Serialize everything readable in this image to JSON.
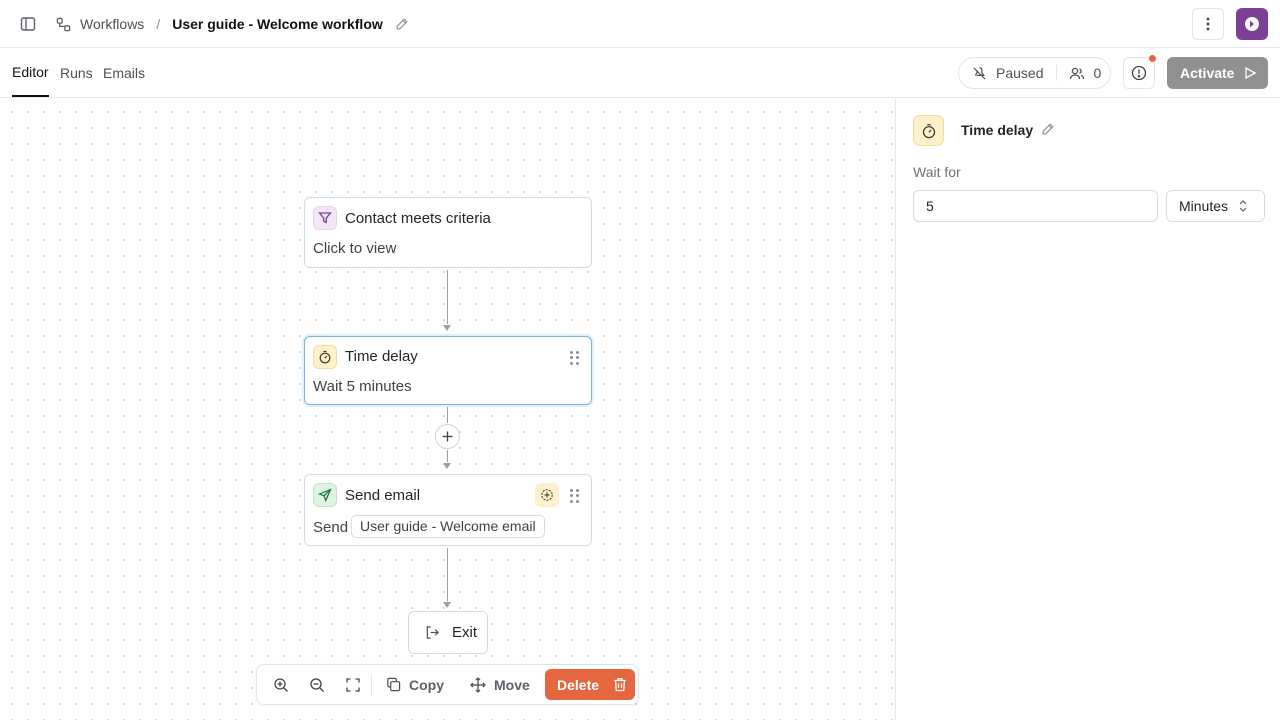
{
  "breadcrumb": {
    "parent": "Workflows",
    "separator": "/",
    "current": "User guide - Welcome workflow"
  },
  "tabs": [
    {
      "label": "Editor",
      "active": true
    },
    {
      "label": "Runs",
      "active": false
    },
    {
      "label": "Emails",
      "active": false
    }
  ],
  "header": {
    "status_label": "Paused",
    "participants_count": "0",
    "activate_label": "Activate"
  },
  "nodes": {
    "trigger": {
      "title": "Contact meets criteria",
      "subtitle": "Click to view",
      "icon": "filter-icon"
    },
    "delay": {
      "title": "Time delay",
      "subtitle": "Wait 5 minutes",
      "icon": "stopwatch-icon"
    },
    "email": {
      "title": "Send email",
      "prefix": "Send",
      "email_name": "User guide - Welcome email",
      "icon": "send-icon"
    },
    "exit": {
      "label": "Exit",
      "icon": "exit-icon"
    }
  },
  "toolbar": {
    "copy_label": "Copy",
    "move_label": "Move",
    "delete_label": "Delete"
  },
  "panel": {
    "title": "Time delay",
    "wait_label": "Wait for",
    "wait_value": "5",
    "unit_value": "Minutes"
  },
  "colors": {
    "delete_bg": "#e5673f",
    "activate_bg": "#8e9092",
    "avatar_bg": "#7b3f98",
    "notify_dot": "#e5673f",
    "delay_icon_bg": "#fdf1cc",
    "trigger_icon_bg": "#f5e6f7",
    "email_icon_bg": "#ddf3e4",
    "selected_border": "#7fb3e6"
  }
}
